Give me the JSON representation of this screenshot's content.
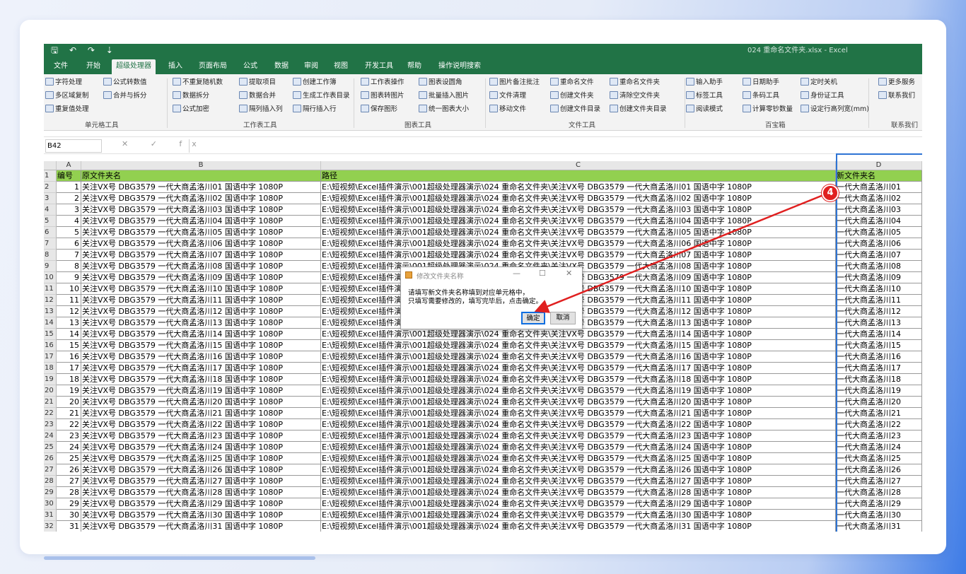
{
  "window": {
    "qat": "🖫 ↶ ↷ ⇣",
    "title": "024 重命名文件夹.xlsx - Excel"
  },
  "tabs": [
    "文件",
    "开始",
    "超级处理器",
    "插入",
    "页面布局",
    "公式",
    "数据",
    "审阅",
    "视图",
    "开发工具",
    "帮助",
    "操作说明搜索"
  ],
  "active_tab": "超级处理器",
  "ribbon": {
    "items": [
      "字符处理",
      "多区域复制",
      "重复值处理",
      "公式转数值",
      "合并与拆分",
      "不重复随机数",
      "数据拆分",
      "公式加密",
      "提取项目",
      "数据合并",
      "隔列插入列",
      "创建工作簿",
      "生成工作表目录",
      "隔行插入行",
      "工作表操作",
      "图表转图片",
      "保存图形",
      "图表设圆角",
      "批量插入图片",
      "统一图表大小",
      "图片备注批注",
      "文件清理",
      "移动文件",
      "重命名文件",
      "创建文件夹",
      "创建文件目录",
      "重命名文件夹",
      "清除空文件夹",
      "创建文件夹目录",
      "输入助手",
      "标签工具",
      "阅读模式",
      "日期助手",
      "条码工具",
      "计算零钞数量",
      "定时关机",
      "身份证工具",
      "设定行高列宽(mm)",
      "更多服务",
      "联系我们"
    ],
    "groups": [
      "单元格工具",
      "工作表工具",
      "图表工具",
      "文件工具",
      "百宝箱",
      "联系我们"
    ]
  },
  "formula_bar": {
    "name_box": "B42",
    "fx": "✕ ✓ fx"
  },
  "columns": [
    "A",
    "B",
    "C",
    "D"
  ],
  "header_row": {
    "num": "1",
    "a": "编号",
    "b": "原文件夹名",
    "c": "路径",
    "d": "新文件夹名"
  },
  "rows": [
    {
      "r": "2",
      "a": "1",
      "b": "关注VX号 DBG3579 一代大商孟洛川01 国语中字 1080P",
      "c": "E:\\短视频\\Excel插件演示\\001超级处理器演示\\024 重命名文件夹\\关注VX号 DBG3579 一代大商孟洛川01 国语中字 1080P",
      "d": "一代大商孟洛川01"
    },
    {
      "r": "3",
      "a": "2",
      "b": "关注VX号 DBG3579 一代大商孟洛川02 国语中字 1080P",
      "c": "E:\\短视频\\Excel插件演示\\001超级处理器演示\\024 重命名文件夹\\关注VX号 DBG3579 一代大商孟洛川02 国语中字 1080P",
      "d": "一代大商孟洛川02"
    },
    {
      "r": "4",
      "a": "3",
      "b": "关注VX号 DBG3579 一代大商孟洛川03 国语中字 1080P",
      "c": "E:\\短视频\\Excel插件演示\\001超级处理器演示\\024 重命名文件夹\\关注VX号 DBG3579 一代大商孟洛川03 国语中字 1080P",
      "d": "一代大商孟洛川03"
    },
    {
      "r": "5",
      "a": "4",
      "b": "关注VX号 DBG3579 一代大商孟洛川04 国语中字 1080P",
      "c": "E:\\短视频\\Excel插件演示\\001超级处理器演示\\024 重命名文件夹\\关注VX号 DBG3579 一代大商孟洛川04 国语中字 1080P",
      "d": "一代大商孟洛川04"
    },
    {
      "r": "6",
      "a": "5",
      "b": "关注VX号 DBG3579 一代大商孟洛川05 国语中字 1080P",
      "c": "E:\\短视频\\Excel插件演示\\001超级处理器演示\\024 重命名文件夹\\关注VX号 DBG3579 一代大商孟洛川05 国语中字 1080P",
      "d": "一代大商孟洛川05"
    },
    {
      "r": "7",
      "a": "6",
      "b": "关注VX号 DBG3579 一代大商孟洛川06 国语中字 1080P",
      "c": "E:\\短视频\\Excel插件演示\\001超级处理器演示\\024 重命名文件夹\\关注VX号 DBG3579 一代大商孟洛川06 国语中字 1080P",
      "d": "一代大商孟洛川06"
    },
    {
      "r": "8",
      "a": "7",
      "b": "关注VX号 DBG3579 一代大商孟洛川07 国语中字 1080P",
      "c": "E:\\短视频\\Excel插件演示\\001超级处理器演示\\024 重命名文件夹\\关注VX号 DBG3579 一代大商孟洛川07 国语中字 1080P",
      "d": "一代大商孟洛川07"
    },
    {
      "r": "9",
      "a": "8",
      "b": "关注VX号 DBG3579 一代大商孟洛川08 国语中字 1080P",
      "c": "E:\\短视频\\Excel插件演示\\001超级处理器演示\\024 重命名文件夹\\关注VX号 DBG3579 一代大商孟洛川08 国语中字 1080P",
      "d": "一代大商孟洛川08"
    },
    {
      "r": "10",
      "a": "9",
      "b": "关注VX号 DBG3579 一代大商孟洛川09 国语中字 1080P",
      "c": "E:\\短视频\\Excel插件演示\\001超级处理器演示\\024 重命名文件夹\\关注VX号 DBG3579 一代大商孟洛川09 国语中字 1080P",
      "d": "一代大商孟洛川09"
    },
    {
      "r": "11",
      "a": "10",
      "b": "关注VX号 DBG3579 一代大商孟洛川10 国语中字 1080P",
      "c": "E:\\短视频\\Excel插件演示\\001超级处理器演示\\024 重命名文件夹\\关注VX号 DBG3579 一代大商孟洛川10 国语中字 1080P",
      "d": "一代大商孟洛川10"
    },
    {
      "r": "12",
      "a": "11",
      "b": "关注VX号 DBG3579 一代大商孟洛川11 国语中字 1080P",
      "c": "E:\\短视频\\Excel插件演示\\001超级处理器演示\\024 重命名文件夹\\关注VX号 DBG3579 一代大商孟洛川11 国语中字 1080P",
      "d": "一代大商孟洛川11"
    },
    {
      "r": "13",
      "a": "12",
      "b": "关注VX号 DBG3579 一代大商孟洛川12 国语中字 1080P",
      "c": "E:\\短视频\\Excel插件演示\\001超级处理器演示\\024 重命名文件夹\\关注VX号 DBG3579 一代大商孟洛川12 国语中字 1080P",
      "d": "一代大商孟洛川12"
    },
    {
      "r": "14",
      "a": "13",
      "b": "关注VX号 DBG3579 一代大商孟洛川13 国语中字 1080P",
      "c": "E:\\短视频\\Excel插件演示\\001超级处理器演示\\024 重命名文件夹\\关注VX号 DBG3579 一代大商孟洛川13 国语中字 1080P",
      "d": "一代大商孟洛川13"
    },
    {
      "r": "15",
      "a": "14",
      "b": "关注VX号 DBG3579 一代大商孟洛川14 国语中字 1080P",
      "c": "E:\\短视频\\Excel插件演示\\001超级处理器演示\\024 重命名文件夹\\关注VX号 DBG3579 一代大商孟洛川14 国语中字 1080P",
      "d": "一代大商孟洛川14"
    },
    {
      "r": "16",
      "a": "15",
      "b": "关注VX号 DBG3579 一代大商孟洛川15 国语中字 1080P",
      "c": "E:\\短视频\\Excel插件演示\\001超级处理器演示\\024 重命名文件夹\\关注VX号 DBG3579 一代大商孟洛川15 国语中字 1080P",
      "d": "一代大商孟洛川15"
    },
    {
      "r": "17",
      "a": "16",
      "b": "关注VX号 DBG3579 一代大商孟洛川16 国语中字 1080P",
      "c": "E:\\短视频\\Excel插件演示\\001超级处理器演示\\024 重命名文件夹\\关注VX号 DBG3579 一代大商孟洛川16 国语中字 1080P",
      "d": "一代大商孟洛川16"
    },
    {
      "r": "18",
      "a": "17",
      "b": "关注VX号 DBG3579 一代大商孟洛川17 国语中字 1080P",
      "c": "E:\\短视频\\Excel插件演示\\001超级处理器演示\\024 重命名文件夹\\关注VX号 DBG3579 一代大商孟洛川17 国语中字 1080P",
      "d": "一代大商孟洛川17"
    },
    {
      "r": "19",
      "a": "18",
      "b": "关注VX号 DBG3579 一代大商孟洛川18 国语中字 1080P",
      "c": "E:\\短视频\\Excel插件演示\\001超级处理器演示\\024 重命名文件夹\\关注VX号 DBG3579 一代大商孟洛川18 国语中字 1080P",
      "d": "一代大商孟洛川18"
    },
    {
      "r": "20",
      "a": "19",
      "b": "关注VX号 DBG3579 一代大商孟洛川19 国语中字 1080P",
      "c": "E:\\短视频\\Excel插件演示\\001超级处理器演示\\024 重命名文件夹\\关注VX号 DBG3579 一代大商孟洛川19 国语中字 1080P",
      "d": "一代大商孟洛川19"
    },
    {
      "r": "21",
      "a": "20",
      "b": "关注VX号 DBG3579 一代大商孟洛川20 国语中字 1080P",
      "c": "E:\\短视频\\Excel插件演示\\001超级处理器演示\\024 重命名文件夹\\关注VX号 DBG3579 一代大商孟洛川20 国语中字 1080P",
      "d": "一代大商孟洛川20"
    },
    {
      "r": "22",
      "a": "21",
      "b": "关注VX号 DBG3579 一代大商孟洛川21 国语中字 1080P",
      "c": "E:\\短视频\\Excel插件演示\\001超级处理器演示\\024 重命名文件夹\\关注VX号 DBG3579 一代大商孟洛川21 国语中字 1080P",
      "d": "一代大商孟洛川21"
    },
    {
      "r": "23",
      "a": "22",
      "b": "关注VX号 DBG3579 一代大商孟洛川22 国语中字 1080P",
      "c": "E:\\短视频\\Excel插件演示\\001超级处理器演示\\024 重命名文件夹\\关注VX号 DBG3579 一代大商孟洛川22 国语中字 1080P",
      "d": "一代大商孟洛川22"
    },
    {
      "r": "24",
      "a": "23",
      "b": "关注VX号 DBG3579 一代大商孟洛川23 国语中字 1080P",
      "c": "E:\\短视频\\Excel插件演示\\001超级处理器演示\\024 重命名文件夹\\关注VX号 DBG3579 一代大商孟洛川23 国语中字 1080P",
      "d": "一代大商孟洛川23"
    },
    {
      "r": "25",
      "a": "24",
      "b": "关注VX号 DBG3579 一代大商孟洛川24 国语中字 1080P",
      "c": "E:\\短视频\\Excel插件演示\\001超级处理器演示\\024 重命名文件夹\\关注VX号 DBG3579 一代大商孟洛川24 国语中字 1080P",
      "d": "一代大商孟洛川24"
    },
    {
      "r": "26",
      "a": "25",
      "b": "关注VX号 DBG3579 一代大商孟洛川25 国语中字 1080P",
      "c": "E:\\短视频\\Excel插件演示\\001超级处理器演示\\024 重命名文件夹\\关注VX号 DBG3579 一代大商孟洛川25 国语中字 1080P",
      "d": "一代大商孟洛川25"
    },
    {
      "r": "27",
      "a": "26",
      "b": "关注VX号 DBG3579 一代大商孟洛川26 国语中字 1080P",
      "c": "E:\\短视频\\Excel插件演示\\001超级处理器演示\\024 重命名文件夹\\关注VX号 DBG3579 一代大商孟洛川26 国语中字 1080P",
      "d": "一代大商孟洛川26"
    },
    {
      "r": "28",
      "a": "27",
      "b": "关注VX号 DBG3579 一代大商孟洛川27 国语中字 1080P",
      "c": "E:\\短视频\\Excel插件演示\\001超级处理器演示\\024 重命名文件夹\\关注VX号 DBG3579 一代大商孟洛川27 国语中字 1080P",
      "d": "一代大商孟洛川27"
    },
    {
      "r": "29",
      "a": "28",
      "b": "关注VX号 DBG3579 一代大商孟洛川28 国语中字 1080P",
      "c": "E:\\短视频\\Excel插件演示\\001超级处理器演示\\024 重命名文件夹\\关注VX号 DBG3579 一代大商孟洛川28 国语中字 1080P",
      "d": "一代大商孟洛川28"
    },
    {
      "r": "30",
      "a": "29",
      "b": "关注VX号 DBG3579 一代大商孟洛川29 国语中字 1080P",
      "c": "E:\\短视频\\Excel插件演示\\001超级处理器演示\\024 重命名文件夹\\关注VX号 DBG3579 一代大商孟洛川29 国语中字 1080P",
      "d": "一代大商孟洛川29"
    },
    {
      "r": "31",
      "a": "30",
      "b": "关注VX号 DBG3579 一代大商孟洛川30 国语中字 1080P",
      "c": "E:\\短视频\\Excel插件演示\\001超级处理器演示\\024 重命名文件夹\\关注VX号 DBG3579 一代大商孟洛川30 国语中字 1080P",
      "d": "一代大商孟洛川30"
    },
    {
      "r": "32",
      "a": "31",
      "b": "关注VX号 DBG3579 一代大商孟洛川31 国语中字 1080P",
      "c": "E:\\短视频\\Excel插件演示\\001超级处理器演示\\024 重命名文件夹\\关注VX号 DBG3579 一代大商孟洛川31 国语中字 1080P",
      "d": "一代大商孟洛川31"
    }
  ],
  "dialog": {
    "title": "修改文件夹名称",
    "min": "—",
    "max": "☐",
    "close": "✕",
    "message_line1": "请填写新文件夹名称填到对应单元格中，",
    "message_line2": "只填写需要修改的，填写完毕后，点击确定。",
    "ok": "确定",
    "cancel": "取消"
  },
  "step_badge": "4",
  "colors": {
    "excel_green": "#217346",
    "header_fill": "#92d050",
    "annotation_red": "#e02020",
    "selection_blue": "#2e74d4"
  }
}
